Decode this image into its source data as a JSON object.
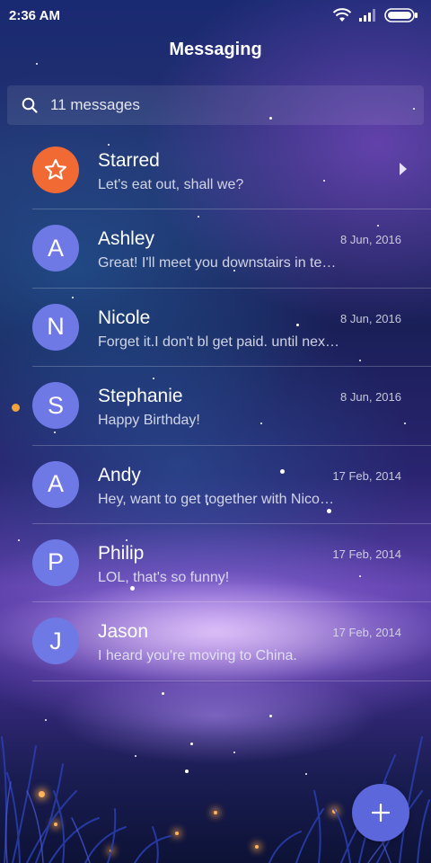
{
  "status_bar": {
    "time": "2:36 AM",
    "icons": [
      "wifi-icon",
      "signal-icon",
      "battery-icon"
    ]
  },
  "header": {
    "title": "Messaging"
  },
  "search": {
    "label": "11 messages",
    "icon": "search-icon"
  },
  "conversations": [
    {
      "name": "Starred",
      "preview": "Let's eat out, shall we?",
      "date": "",
      "avatar": "star-icon",
      "avatar_color": "#f26a33"
    },
    {
      "name": "Ashley",
      "preview": "Great! I'll meet you downstairs in te…",
      "date": "8 Jun, 2016",
      "avatar": "A",
      "avatar_color": "#6e79e6"
    },
    {
      "name": "Nicole",
      "preview": "Forget it.I don't bl get paid. until nex…",
      "date": "8 Jun, 2016",
      "avatar": "N",
      "avatar_color": "#6e79e6"
    },
    {
      "name": "Stephanie",
      "preview": "Happy Birthday!",
      "date": "8 Jun, 2016",
      "avatar": "S",
      "avatar_color": "#6e79e6",
      "unread": true
    },
    {
      "name": "Andy",
      "preview": "Hey, want to get together with Nico…",
      "date": "17 Feb, 2014",
      "avatar": "A",
      "avatar_color": "#6e79e6"
    },
    {
      "name": "Philip",
      "preview": "LOL, that's so funny!",
      "date": "17 Feb, 2014",
      "avatar": "P",
      "avatar_color": "#6e79e6"
    },
    {
      "name": "Jason",
      "preview": "I heard you're moving to China.",
      "date": "17 Feb, 2014",
      "avatar": "J",
      "avatar_color": "#6e79e6"
    }
  ],
  "fab": {
    "icon": "plus-icon",
    "color": "#5b67db"
  },
  "colors": {
    "unread_dot": "#f2a33a",
    "starred_avatar": "#f26a33",
    "contact_avatar": "#6e79e6"
  }
}
